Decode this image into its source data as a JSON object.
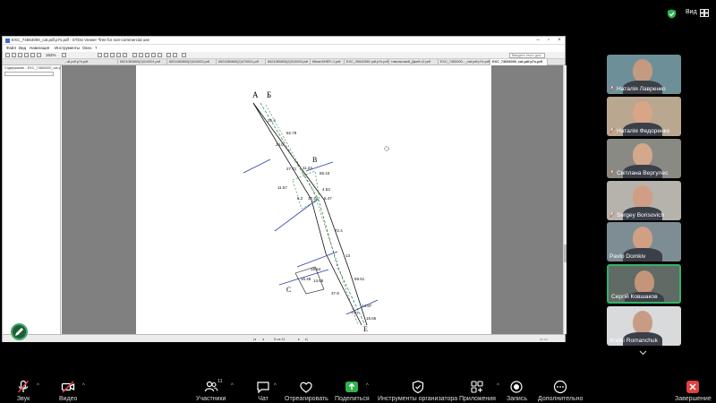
{
  "header": {
    "view_label": "Вид"
  },
  "share": {
    "title": "EXC_74654000_cat.pdf.p7s.pdf - STDU Viewer *free for non-commercial use",
    "menu": [
      "Файл",
      "Вид",
      "Навигация",
      "Инструменты",
      "Окно",
      "?"
    ],
    "zoom": "152%",
    "search_placeholder": "Введите текст для поиска",
    "tabs": [
      "...at.pdf.p7s.pdf",
      "6521080800(2)010001.pdf",
      "6521080800(2)010002.pdf",
      "6521080800(2)070001.pdf",
      "6521080800(2)010003.pdf",
      "MleanSHEFr-1.pdf",
      "EXC_30640561.pdf.p7s.pdf",
      "тимчасовий_Джей с2.pdf",
      "EXC_7465000..._cat.pdf.p7s.pdf",
      "EXC_74654000_cat.pdf.p7s.pdf"
    ],
    "sidebar_title": "Содержание - EXC_74654000_cat.p",
    "page_indicator": "5 из 11",
    "drawing": {
      "labels": {
        "a": "А",
        "b": "Б",
        "v": "В",
        "s": "С",
        "e": "Е"
      },
      "dims": [
        "25.4",
        "82.79",
        "24.0",
        "27.71",
        "11.24",
        "11.57",
        "65.43",
        "6.2",
        "17.44",
        "4.53",
        "5.47",
        "72.4",
        "13",
        "18.54",
        "16.48",
        "59.51",
        "14.97",
        "37.9",
        "7.77",
        "15.65",
        "14.68"
      ]
    }
  },
  "participants": [
    {
      "name": "Наталія Лавренко",
      "mic_muted": true,
      "pinned": true,
      "bg": "#6d8f98",
      "skin": "#c49a80"
    },
    {
      "name": "Наталія Федоренко",
      "mic_muted": true,
      "bg": "#b9a78f",
      "skin": "#d9a589"
    },
    {
      "name": "Світлана Вергулес",
      "mic_muted": true,
      "bg": "#8a8a84",
      "skin": "#d4a88b"
    },
    {
      "name": "Sergey Borisovich",
      "mic_muted": true,
      "bg": "#b6b3ad",
      "skin": "#cf9e84"
    },
    {
      "name": "Pavlo Domkiv",
      "mic_muted": false,
      "bg": "#7d8d93",
      "skin": "#d0a085"
    },
    {
      "name": "Сергій Ковшаков",
      "mic_muted": false,
      "bg": "#5f6b64",
      "skin": "#c4947b",
      "speaking": true
    },
    {
      "name": "Andrii Romanchuk",
      "mic_muted": false,
      "bg": "#d9dadc",
      "skin": "#c89c84"
    }
  ],
  "toolbar": {
    "mute_label": "Звук",
    "video_label": "Видео",
    "participants_label": "Участники",
    "participants_count": "11",
    "chat_label": "Чат",
    "react_label": "Отреагировать",
    "share_label": "Поделиться",
    "host_tools_label": "Инструменты организатора",
    "apps_label": "Приложения",
    "record_label": "Запись",
    "more_label": "Дополнительно",
    "end_label": "Завершение"
  },
  "colors": {
    "accent_green": "#35b36a",
    "share_green": "#2fb14d",
    "end_red": "#e04141"
  }
}
